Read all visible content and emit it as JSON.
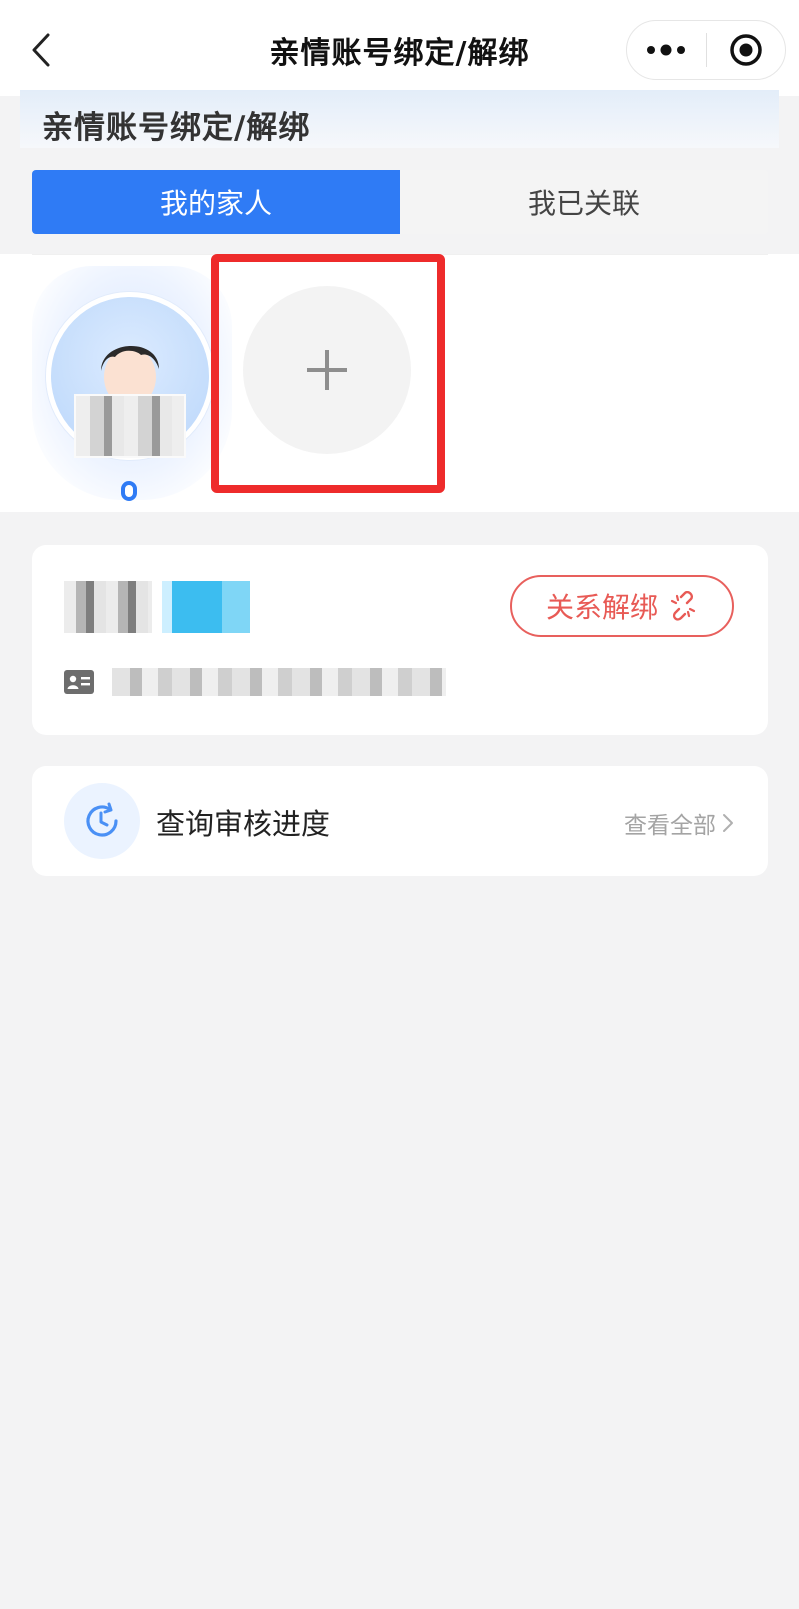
{
  "navbar": {
    "title": "亲情账号绑定/解绑",
    "back_icon": "chevron-left-icon",
    "more_icon": "more-dots-icon",
    "close_icon": "record-target-icon"
  },
  "hero": {
    "title": "亲情账号绑定/解绑"
  },
  "tabs": [
    {
      "label": "我的家人",
      "active": true
    },
    {
      "label": "我已关联",
      "active": false
    }
  ],
  "members": {
    "selected_member": {
      "avatar_icon": "person-avatar-icon",
      "name": ""
    },
    "add_icon": "plus-icon"
  },
  "info_card": {
    "name": "",
    "tag": "",
    "id_number": "",
    "unbind_label": "关系解绑",
    "unbind_icon": "broken-link-icon",
    "id_icon": "id-card-icon"
  },
  "progress": {
    "label": "查询审核进度",
    "view_all": "查看全部",
    "icon": "clock-refresh-icon"
  },
  "colors": {
    "primary": "#2f7bf5",
    "danger": "#e85a55",
    "highlight": "#ee2b2b",
    "page_bg": "#f3f3f4"
  }
}
